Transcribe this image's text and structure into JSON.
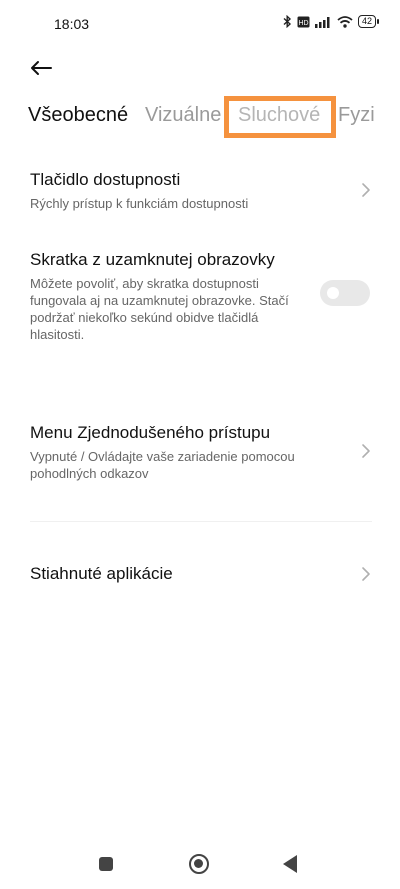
{
  "status_bar": {
    "time": "18:03",
    "battery": "42",
    "icons": [
      "bluetooth-icon",
      "sim-icon",
      "signal-icon",
      "wifi-icon",
      "battery-icon"
    ]
  },
  "header": {
    "back_icon": "arrow-left-icon"
  },
  "tabs": [
    {
      "label": "Všeobecné",
      "active": true
    },
    {
      "label": "Vizuálne",
      "active": false
    },
    {
      "label": "Sluchové",
      "active": false,
      "highlighted": true,
      "highlight_color": "#f5923e"
    },
    {
      "label": "Fyzi",
      "active": false
    }
  ],
  "settings": [
    {
      "title": "Tlačidlo dostupnosti",
      "subtitle": "Rýchly prístup k funkciám dostupnosti",
      "control": "chevron"
    },
    {
      "title": "Skratka z uzamknutej obrazovky",
      "subtitle_lines": [
        "Môžete povoliť, aby skratka dostupnosti",
        "fungovala aj na uzamknutej obrazovke. Stačí",
        "podržať niekoľko sekúnd obidve tlačidlá",
        "hlasitosti."
      ],
      "control": "toggle",
      "toggle_on": false
    },
    {
      "title": "Menu Zjednodušeného prístupu",
      "subtitle_lines": [
        "Vypnuté / Ovládajte vaše zariadenie pomocou",
        "pohodlných odkazov"
      ],
      "control": "chevron"
    },
    {
      "title": "Stiahnuté aplikácie",
      "control": "chevron"
    }
  ],
  "nav_bar": {
    "icons": [
      "recents-square-icon",
      "home-circle-icon",
      "back-triangle-icon"
    ]
  },
  "colors": {
    "highlight": "#f5923e",
    "tab_inactive": "#9a9a9a",
    "toggle_off": "#e8e8e8"
  }
}
